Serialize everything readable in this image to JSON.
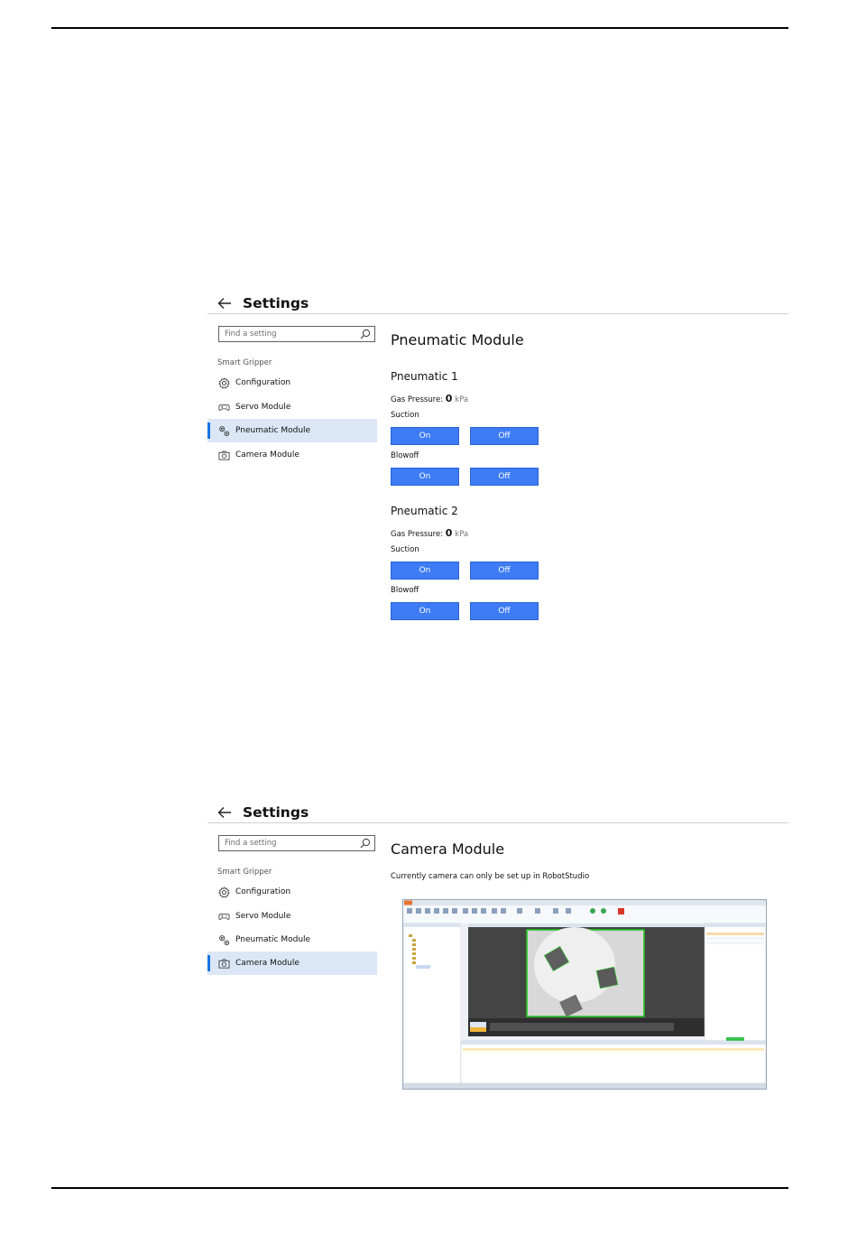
{
  "screenshot_top": {
    "header": {
      "title": "Settings"
    },
    "search": {
      "placeholder": "Find a setting"
    },
    "nav": {
      "group": "Smart Gripper",
      "items": [
        {
          "label": "Configuration",
          "icon": "gear-icon"
        },
        {
          "label": "Servo Module",
          "icon": "gamepad-icon"
        },
        {
          "label": "Pneumatic Module",
          "icon": "gears-icon",
          "active": true
        },
        {
          "label": "Camera Module",
          "icon": "camera-icon"
        }
      ]
    },
    "page": {
      "title": "Pneumatic Module",
      "sections": [
        {
          "title": "Pneumatic 1",
          "gas_label": "Gas Pressure:",
          "gas_value": "0",
          "gas_unit": "kPa",
          "suction_label": "Suction",
          "blowoff_label": "Blowoff",
          "on_label": "On",
          "off_label": "Off"
        },
        {
          "title": "Pneumatic 2",
          "gas_label": "Gas Pressure:",
          "gas_value": "0",
          "gas_unit": "kPa",
          "suction_label": "Suction",
          "blowoff_label": "Blowoff",
          "on_label": "On",
          "off_label": "Off"
        }
      ]
    }
  },
  "screenshot_bottom": {
    "header": {
      "title": "Settings"
    },
    "search": {
      "placeholder": "Find a setting"
    },
    "nav": {
      "group": "Smart Gripper",
      "items": [
        {
          "label": "Configuration",
          "icon": "gear-icon"
        },
        {
          "label": "Servo Module",
          "icon": "gamepad-icon"
        },
        {
          "label": "Pneumatic Module",
          "icon": "gears-icon"
        },
        {
          "label": "Camera Module",
          "icon": "camera-icon",
          "active": true
        }
      ]
    },
    "page": {
      "title": "Camera Module",
      "note": "Currently camera can only be set up in RobotStudio"
    }
  },
  "colors": {
    "button": "#3d7cf5",
    "active_nav": "#dbe7f7",
    "active_indicator": "#1a73e8"
  }
}
